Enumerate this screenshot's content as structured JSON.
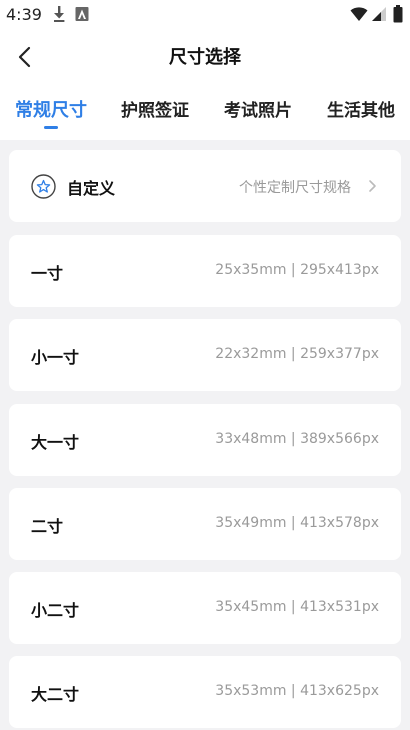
{
  "status_bar": {
    "time": "4:39",
    "icons": [
      "download-icon",
      "font-a-icon",
      "wifi-icon",
      "signal-icon",
      "battery-icon"
    ]
  },
  "header": {
    "back_icon": "chevron-left-icon",
    "title": "尺寸选择"
  },
  "tabs": [
    {
      "label": "常规尺寸",
      "active": true
    },
    {
      "label": "护照签证",
      "active": false
    },
    {
      "label": "考试照片",
      "active": false
    },
    {
      "label": "生活其他",
      "active": false
    }
  ],
  "custom": {
    "icon": "star-icon",
    "label": "自定义",
    "description": "个性定制尺寸规格",
    "chevron": "chevron-right-icon"
  },
  "sizes": [
    {
      "name": "一寸",
      "spec": "25x35mm | 295x413px"
    },
    {
      "name": "小一寸",
      "spec": "22x32mm | 259x377px"
    },
    {
      "name": "大一寸",
      "spec": "33x48mm | 389x566px"
    },
    {
      "name": "二寸",
      "spec": "35x49mm | 413x578px"
    },
    {
      "name": "小二寸",
      "spec": "35x45mm | 413x531px"
    },
    {
      "name": "大二寸",
      "spec": "35x53mm | 413x625px"
    }
  ],
  "colors": {
    "accent": "#2f7fe6",
    "background": "#f2f2f4",
    "card": "#ffffff",
    "muted_text": "#9a9a9a"
  }
}
